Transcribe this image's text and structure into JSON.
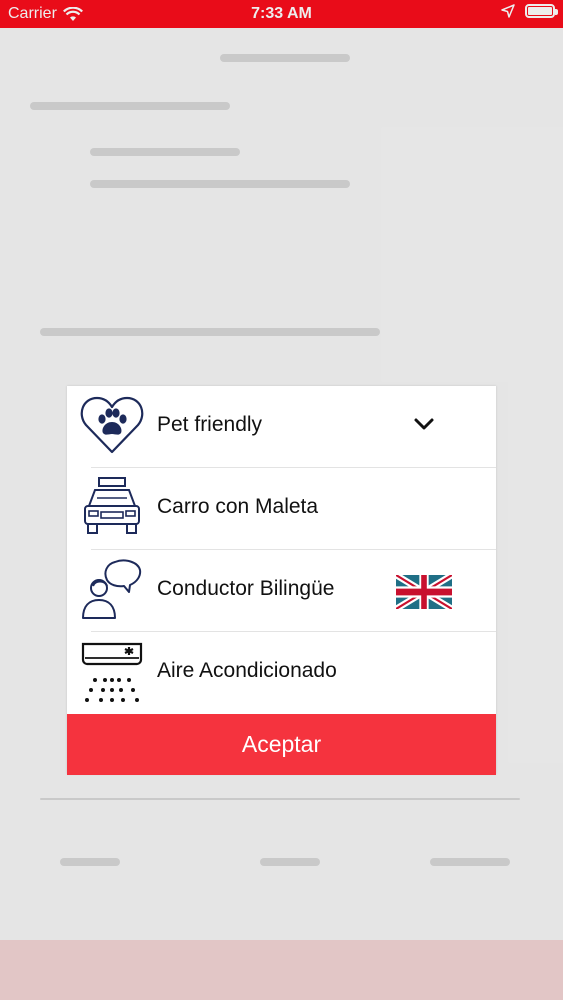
{
  "status_bar": {
    "carrier": "Carrier",
    "time": "7:33 AM",
    "battery_level": 1.0,
    "icons": [
      "wifi-icon",
      "location-arrow-icon",
      "battery-icon"
    ],
    "color": "#fb0d1b"
  },
  "modal": {
    "options": [
      {
        "label": "Pet friendly",
        "icon": "paw-heart-icon",
        "selected": true
      },
      {
        "label": "Carro con Maleta",
        "icon": "car-luggage-icon"
      },
      {
        "label": "Conductor Bilingüe",
        "icon": "bilingual-driver-icon",
        "badge": "uk-flag-icon"
      },
      {
        "label": "Aire Acondicionado",
        "icon": "air-conditioner-icon"
      }
    ],
    "accept_label": "Aceptar",
    "accept_color": "#f5333e"
  }
}
